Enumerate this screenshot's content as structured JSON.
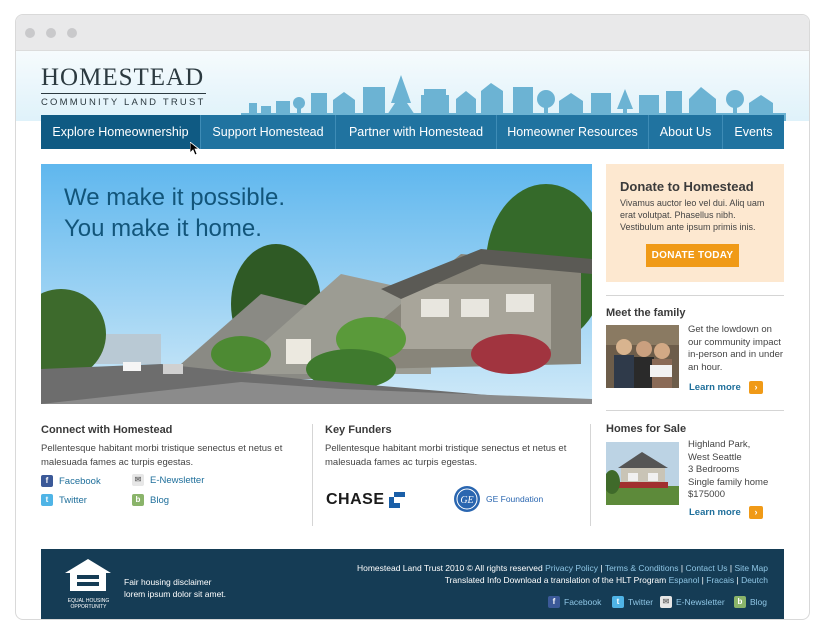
{
  "logo": {
    "title": "Homestead",
    "subtitle": "Community Land Trust"
  },
  "nav": [
    {
      "label": "Explore Homeownership"
    },
    {
      "label": "Support Homestead"
    },
    {
      "label": "Partner with Homestead"
    },
    {
      "label": "Homeowner Resources"
    },
    {
      "label": "About Us"
    },
    {
      "label": "Events"
    }
  ],
  "hero": {
    "line1": "We make it possible.",
    "line2": "You make it home."
  },
  "donate": {
    "title": "Donate to Homestead",
    "text": "Vivamus auctor leo vel dui. Aliq uam erat volutpat. Phasellus nibh. Vestibulum ante ipsum primis inis.",
    "button": "DONATE TODAY"
  },
  "family": {
    "title": "Meet the family",
    "text": "Get the lowdown on our community impact in-person and in under an hour.",
    "link": "Learn more"
  },
  "homes": {
    "title": "Homes for Sale",
    "line1": "Highland Park,",
    "line2": "West Seattle",
    "line3": "3 Bedrooms",
    "line4": "Single family home",
    "line5": "$175000",
    "link": "Learn more"
  },
  "connect": {
    "title": "Connect with Homestead",
    "text": "Pellentesque habitant morbi tristique senectus et netus et malesuada fames ac turpis egestas.",
    "links": {
      "facebook": "Facebook",
      "enewsletter": "E-Newsletter",
      "twitter": "Twitter",
      "blog": "Blog"
    }
  },
  "funders": {
    "title": "Key Funders",
    "text": "Pellentesque habitant morbi tristique senectus et netus et malesuada fames ac turpis egestas.",
    "chase": "CHASE",
    "ge_logo": "GE",
    "ge": "GE Foundation"
  },
  "footer": {
    "badge_line1": "EQUAL HOUSING",
    "badge_line2": "OPPORTUNITY",
    "disclaimer1": "Fair housing disclaimer",
    "disclaimer2": "lorem ipsum dolor sit amet.",
    "copyright": "Homestead Land Trust 2010 © All rights reserved",
    "links1": [
      "Privacy Policy",
      "Terms & Conditions",
      "Contact Us",
      "Site Map"
    ],
    "translated": "Translated Info Download a translation of the HLT Program",
    "links2": [
      "Espanol",
      "Fracais",
      "Deutch"
    ],
    "social": {
      "facebook": "Facebook",
      "twitter": "Twitter",
      "enewsletter": "E-Newsletter",
      "blog": "Blog"
    }
  },
  "colors": {
    "nav": "#2073a0",
    "nav_active": "#0f5a83",
    "accent": "#f09a17",
    "footer": "#153c55",
    "link": "#1f6f9b"
  }
}
